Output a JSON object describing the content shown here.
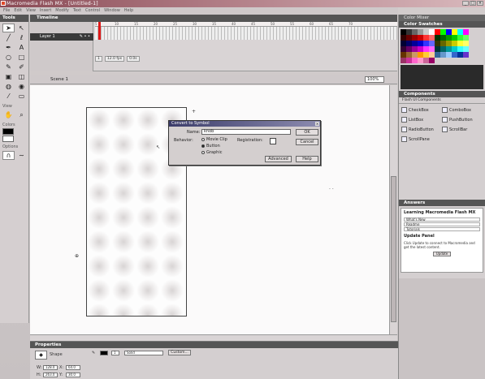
{
  "window": {
    "title": "Macromedia Flash MX - [Untitled-1]"
  },
  "menu": [
    "File",
    "Edit",
    "View",
    "Insert",
    "Modify",
    "Text",
    "Control",
    "Window",
    "Help"
  ],
  "tools": {
    "header": "Tools",
    "view_label": "View",
    "colors_label": "Colors",
    "options_label": "Options"
  },
  "timeline": {
    "header": "Timeline",
    "layer_name": "Layer 1",
    "ruler": [
      "5",
      "10",
      "15",
      "20",
      "25",
      "30",
      "35",
      "40",
      "45",
      "50",
      "55",
      "60",
      "65",
      "70"
    ],
    "frame": "1",
    "fps": "12.0 fps",
    "time": "0.0s"
  },
  "scene": {
    "name": "Scene 1",
    "zoom": "100%"
  },
  "dialog": {
    "title": "Convert to Symbol",
    "name_label": "Name:",
    "name_value": "knob",
    "behavior_label": "Behavior:",
    "behaviors": [
      "Movie Clip",
      "Button",
      "Graphic"
    ],
    "selected": "Button",
    "registration_label": "Registration:",
    "buttons": {
      "ok": "OK",
      "cancel": "Cancel",
      "advanced": "Advanced",
      "help": "Help"
    }
  },
  "panels": {
    "color_mixer": "Color Mixer",
    "color_swatches": "Color Swatches",
    "components": "Components",
    "components_sub": "Flash UI Components",
    "component_items": [
      "CheckBox",
      "ComboBox",
      "ListBox",
      "PushButton",
      "RadioButton",
      "ScrollBar",
      "ScrollPane"
    ],
    "answers": "Answers",
    "answers_heading": "Learning Macromedia Flash MX",
    "answers_rows": [
      "What's New",
      "Readme",
      "Tutorials"
    ],
    "update_heading": "Update Panel",
    "update_text": "Click Update to connect to Macromedia and get the latest content.",
    "update_button": "Update"
  },
  "properties": {
    "header": "Properties",
    "instance": "Shape",
    "stroke": "1",
    "style": "Solid",
    "custom": "Custom...",
    "w": "W:",
    "h": "H:",
    "x": "X:",
    "y": "Y:",
    "w_val": "128.0",
    "h_val": "263.0",
    "x_val": "64.0",
    "y_val": "30.0"
  },
  "colors": {
    "title_start": "#8a4a55",
    "playhead": "#e01818",
    "panel_header": "#555555"
  },
  "swatch_colors": [
    "#000000",
    "#333333",
    "#666666",
    "#999999",
    "#cccccc",
    "#ffffff",
    "#ff0000",
    "#00ff00",
    "#0000ff",
    "#ffff00",
    "#00ffff",
    "#ff00ff",
    "#330000",
    "#660000",
    "#990000",
    "#cc0000",
    "#ff3333",
    "#ff6666",
    "#003300",
    "#006600",
    "#009900",
    "#00cc00",
    "#33ff33",
    "#66ff66",
    "#000033",
    "#000066",
    "#000099",
    "#0000cc",
    "#3333ff",
    "#6666ff",
    "#333300",
    "#666600",
    "#999900",
    "#cccc00",
    "#ffff33",
    "#ffff66",
    "#330033",
    "#660066",
    "#990099",
    "#cc00cc",
    "#ff33ff",
    "#ff66ff",
    "#003333",
    "#006666",
    "#009999",
    "#00cccc",
    "#33ffff",
    "#66ffff",
    "#663300",
    "#996633",
    "#cc9966",
    "#ff9900",
    "#ffcc33",
    "#ffcc99",
    "#336699",
    "#6699cc",
    "#99ccff",
    "#3366cc",
    "#003399",
    "#6633cc",
    "#993366",
    "#cc3399",
    "#ff66cc",
    "#ff99cc",
    "#cc6699",
    "#990066"
  ]
}
